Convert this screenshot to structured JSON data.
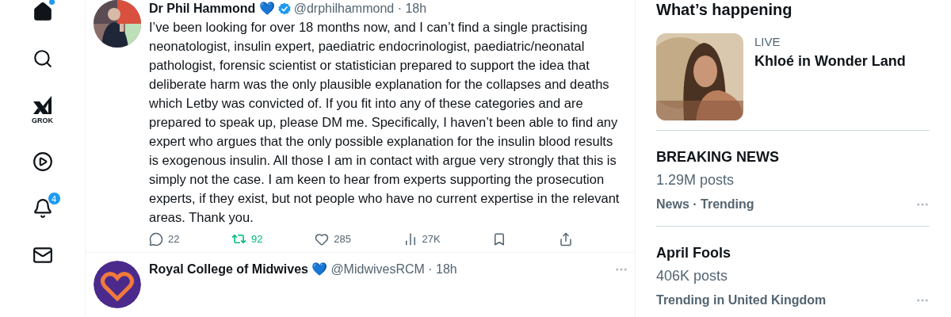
{
  "nav": [
    {
      "kind": "home",
      "dot": true
    },
    {
      "kind": "search",
      "dot": false
    },
    {
      "kind": "grok",
      "label": "GROK"
    },
    {
      "kind": "video",
      "dot": false
    },
    {
      "kind": "bell",
      "badge": "4"
    },
    {
      "kind": "mail",
      "dot": false
    }
  ],
  "tweets": [
    {
      "name": "Dr Phil Hammond 💙",
      "verified": true,
      "meta": "@drphilhammond · 18h",
      "text": "I’ve been looking for over 18 months now, and I can’t find a single practising neonatologist, insulin expert, paediatric endocrinologist, paediatric/neonatal pathologist, forensic scientist or statistician prepared to support the idea that deliberate harm was the only plausible explanation for the collapses and deaths which Letby was convicted of. If you fit into any of these categories and are prepared to speak up, please DM me. Specifically, I haven’t been able to find any expert who argues that the only possible explanation for the insulin blood results is exogenous insulin. All those I am in contact with argue very strongly that this is simply not the case. I am keen to hear from experts supporting the prosecution experts, if they exist, but not people who have no current expertise in the relevant areas. Thank you.",
      "actions": {
        "replies": "22",
        "reposts": "92",
        "reposted": true,
        "likes": "285",
        "views": "27K"
      }
    },
    {
      "name": "Royal College of Midwives 💙",
      "verified": false,
      "meta": "@MidwivesRCM · 18h"
    }
  ],
  "sidebar": {
    "title": "What’s happening",
    "trends": [
      {
        "kind": "featured",
        "label": "LIVE",
        "title": "Khloé in Wonder Land"
      },
      {
        "kind": "trend",
        "title": "BREAKING NEWS",
        "posts": "1.29M posts",
        "context": "News · Trending"
      },
      {
        "kind": "trend",
        "title": "April Fools",
        "posts": "406K posts",
        "context": "Trending in United Kingdom"
      }
    ]
  }
}
